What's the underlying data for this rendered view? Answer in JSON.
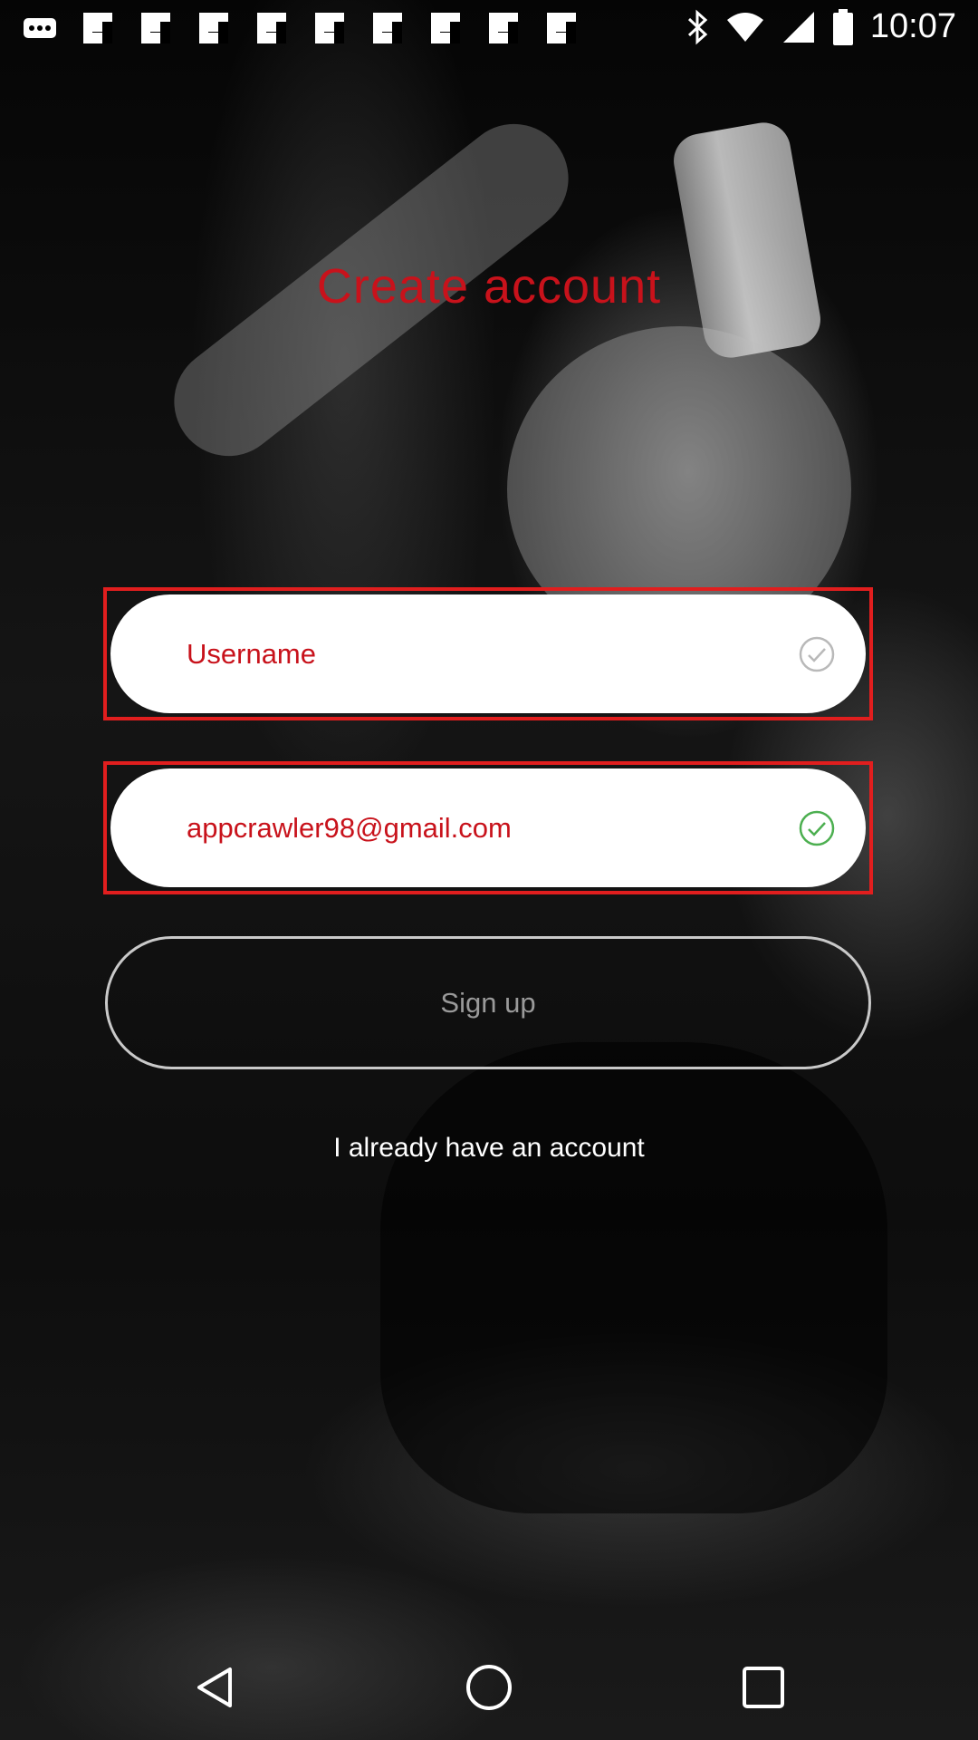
{
  "status_bar": {
    "time": "10:07",
    "notification_icons": [
      "more-icon",
      "flipboard-icon",
      "flipboard-icon",
      "flipboard-icon",
      "flipboard-icon",
      "flipboard-icon",
      "flipboard-icon",
      "flipboard-icon",
      "flipboard-icon",
      "flipboard-icon"
    ],
    "right_icons": [
      "bluetooth-icon",
      "wifi-icon",
      "signal-icon",
      "battery-icon"
    ]
  },
  "screen": {
    "title": "Create account",
    "username_field": {
      "placeholder": "Username",
      "status_icon": "check-circle-icon",
      "valid": false
    },
    "email_field": {
      "value": "appcrawler98@gmail.com",
      "status_icon": "check-circle-icon",
      "valid": true
    },
    "signup_button": "Sign up",
    "login_link": "I already have an account"
  },
  "nav_bar": {
    "buttons": [
      "back-icon",
      "home-icon",
      "recents-icon"
    ]
  },
  "colors": {
    "accent_red": "#c8121b",
    "highlight_border": "#e11e1e",
    "check_inactive": "#b9b9b9",
    "check_active": "#4caf50"
  }
}
